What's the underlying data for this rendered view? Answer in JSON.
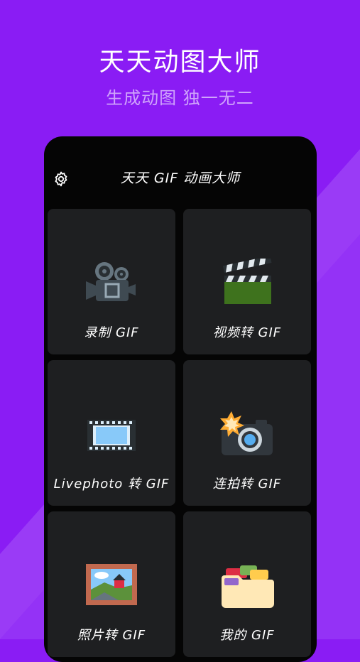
{
  "hero": {
    "title": "天天动图大师",
    "subtitle": "生成动图 独一无二"
  },
  "app": {
    "title": "天天 GIF 动画大师",
    "settings_icon": "gear-icon"
  },
  "tiles": [
    {
      "label": "录制 GIF",
      "icon": "movie-camera-icon"
    },
    {
      "label": "视频转 GIF",
      "icon": "clapper-board-icon"
    },
    {
      "label": "Livephoto 转 GIF",
      "icon": "film-strip-icon"
    },
    {
      "label": "连拍转 GIF",
      "icon": "camera-flash-icon"
    },
    {
      "label": "照片转 GIF",
      "icon": "framed-picture-icon"
    },
    {
      "label": "我的 GIF",
      "icon": "folder-icon"
    }
  ],
  "colors": {
    "background": "#8a1cf4",
    "panel": "#050505",
    "tile": "#1e1f21"
  }
}
